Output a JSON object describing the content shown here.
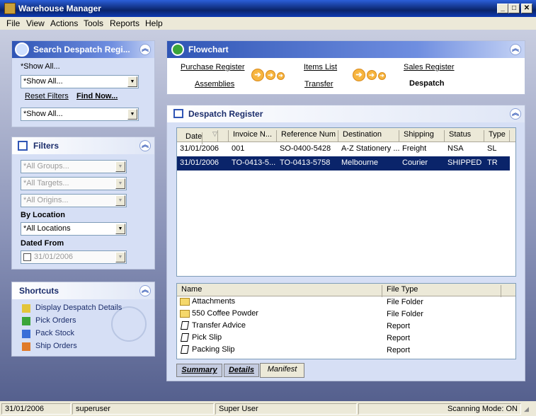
{
  "window": {
    "title": "Warehouse Manager",
    "min": "_",
    "max": "□",
    "close": "✕"
  },
  "menu": [
    "File",
    "View",
    "Actions",
    "Tools",
    "Reports",
    "Help"
  ],
  "search": {
    "title": "Search Despatch Regi...",
    "show_all_label": "*Show All...",
    "combo1": "*Show All...",
    "reset_filters": "Reset Filters",
    "find_now": "Find Now...",
    "combo2": "*Show All..."
  },
  "filters": {
    "title": "Filters",
    "groups": "*All Groups...",
    "targets": "*All Targets...",
    "origins": "*All Origins...",
    "by_location_label": "By Location",
    "location": "*All Locations",
    "dated_from_label": "Dated From",
    "dated_from": "31/01/2006"
  },
  "shortcuts": {
    "title": "Shortcuts",
    "items": [
      "Display Despatch Details",
      "Pick Orders",
      "Pack Stock",
      "Ship Orders"
    ]
  },
  "flowchart": {
    "title": "Flowchart",
    "purchase_register": "Purchase Register",
    "assemblies": "Assemblies",
    "items_list": "Items List",
    "transfer": "Transfer",
    "sales_register": "Sales Register",
    "despatch": "Despatch"
  },
  "register": {
    "title": "Despatch Register",
    "columns": [
      "Date",
      "Invoice N...",
      "Reference Num",
      "Destination",
      "Shipping",
      "Status",
      "Type"
    ],
    "rows": [
      [
        "31/01/2006",
        "001",
        "SO-0400-5428",
        "A-Z Stationery ...",
        "Freight",
        "NSA",
        "SL"
      ],
      [
        "31/01/2006",
        "TO-0413-5...",
        "TO-0413-5758",
        "Melbourne",
        "Courier",
        "SHIPPED",
        "TR"
      ]
    ]
  },
  "files": {
    "columns": [
      "Name",
      "File Type"
    ],
    "rows": [
      {
        "name": "Attachments",
        "type": "File Folder",
        "icon": "folder-icon"
      },
      {
        "name": "550 Coffee Powder",
        "type": "File Folder",
        "icon": "folder-icon"
      },
      {
        "name": "Transfer Advice",
        "type": "Report",
        "icon": "report-icon"
      },
      {
        "name": "Pick Slip",
        "type": "Report",
        "icon": "report-icon"
      },
      {
        "name": "Packing Slip",
        "type": "Report",
        "icon": "report-icon"
      }
    ]
  },
  "tabs": [
    "Summary",
    "Details",
    "Manifest"
  ],
  "status": {
    "date": "31/01/2006",
    "user": "superuser",
    "role": "Super User",
    "scanning": "Scanning Mode: ON"
  }
}
